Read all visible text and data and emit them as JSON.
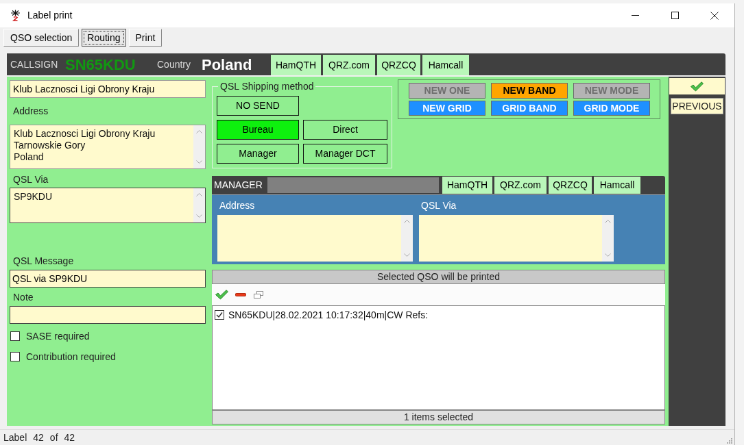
{
  "window": {
    "title": "Label print"
  },
  "tabs": [
    {
      "label": "QSO selection",
      "selected": false
    },
    {
      "label": "Routing",
      "selected": true
    },
    {
      "label": "Print",
      "selected": false
    }
  ],
  "callsign_bar": {
    "callsign_label": "CALLSIGN",
    "callsign": "SN65KDU",
    "country_label": "Country",
    "country": "Poland",
    "lookups": [
      "HamQTH",
      "QRZ.com",
      "QRZCQ",
      "Hamcall"
    ]
  },
  "station": {
    "name": "Klub Lacznosci Ligi Obrony Kraju",
    "address_label": "Address",
    "address": [
      "Klub Lacznosci Ligi Obrony Kraju",
      "Tarnowskie Gory",
      "Poland"
    ],
    "qsl_via_label": "QSL Via",
    "qsl_via": "SP9KDU",
    "qsl_message_label": "QSL Message",
    "qsl_message": "QSL via SP9KDU",
    "note_label": "Note",
    "options": [
      {
        "label": "SASE required",
        "checked": false
      },
      {
        "label": "Contribution required",
        "checked": false
      }
    ]
  },
  "shipping": {
    "title": "QSL Shipping method",
    "methods": [
      {
        "label": "NO SEND",
        "selected": false
      },
      {
        "label": "Bureau",
        "selected": true
      },
      {
        "label": "Direct",
        "selected": false
      },
      {
        "label": "Manager",
        "selected": false
      },
      {
        "label": "Manager DCT",
        "selected": false
      }
    ]
  },
  "flags": [
    {
      "label": "NEW ONE",
      "kind": "dxcc",
      "active": false
    },
    {
      "label": "NEW BAND",
      "kind": "dxcc",
      "active": true
    },
    {
      "label": "NEW MODE",
      "kind": "dxcc",
      "active": false
    },
    {
      "label": "NEW GRID",
      "kind": "grid",
      "active": true
    },
    {
      "label": "GRID BAND",
      "kind": "grid",
      "active": true
    },
    {
      "label": "GRID MODE",
      "kind": "grid",
      "active": true
    }
  ],
  "manager": {
    "title": "MANAGER",
    "lookups": [
      "HamQTH",
      "QRZ.com",
      "QRZCQ",
      "Hamcall"
    ],
    "address_label": "Address",
    "qsl_via_label": "QSL Via"
  },
  "qso_list": {
    "header": "Selected QSO will be printed",
    "items": [
      {
        "text": "SN65KDU|28.02.2021 10:17:32|40m|CW Refs:",
        "checked": true
      }
    ],
    "footer": "1 items selected"
  },
  "side_panel": {
    "previous": "PREVIOUS"
  },
  "status_bar": {
    "label": "Label",
    "current": "42",
    "separator": "of",
    "total": "42"
  }
}
